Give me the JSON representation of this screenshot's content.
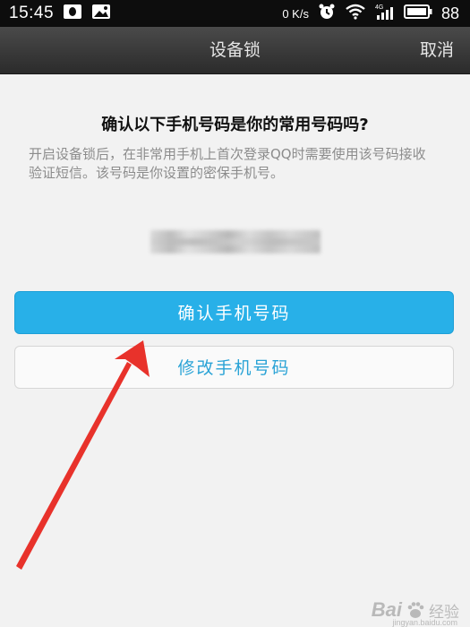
{
  "status_bar": {
    "time": "15:45",
    "network": "0 K/s",
    "battery": "88",
    "icons": [
      "qq-notification-icon",
      "image-notification-icon",
      "alarm-icon",
      "wifi-icon",
      "4g-signal-icon",
      "battery-icon"
    ]
  },
  "nav": {
    "title": "设备锁",
    "cancel_label": "取消"
  },
  "main": {
    "question": "确认以下手机号码是你的常用号码吗?",
    "description": "开启设备锁后，在非常用手机上首次登录QQ时需要使用该号码接收验证短信。该号码是你设置的密保手机号。",
    "confirm_button": "确认手机号码",
    "modify_button": "修改手机号码"
  },
  "annotation": {
    "arrow_color": "#e8322b"
  },
  "watermark": {
    "brand_left": "Bai",
    "brand_right": "经验",
    "url": "jingyan.baidu.com"
  },
  "colors": {
    "status_bar": "#0d0d0d",
    "nav_bar": "#333333",
    "background": "#f2f2f2",
    "primary_button": "#28b0e8",
    "secondary_text": "#2aa3d6"
  }
}
